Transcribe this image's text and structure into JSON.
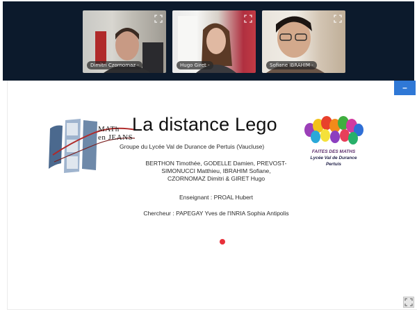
{
  "meeting": {
    "participants": [
      {
        "name": "Dimitri Czornomaz -"
      },
      {
        "name": "Hugo Giret -"
      },
      {
        "name": "Sofiane IBRAHIM -"
      }
    ]
  },
  "controls": {
    "minimize_label": "–",
    "expand_icon": "expand-icon",
    "fullscreen_icon": "fullscreen-icon"
  },
  "slide": {
    "title": "La distance Lego",
    "subtitle": "Groupe du Lycée Val de Durance de Pertuis (Vaucluse)",
    "authors_line1": "BERTHON Timothée, GODELLE Damien, PREVOST-",
    "authors_line2": "SIMONUCCI Matthieu, IBRAHIM Sofiane,",
    "authors_line3": "CZORNOMAZ Dimitri & GIRET Hugo",
    "teacher": "Enseignant : PROAL Hubert",
    "researcher": "Chercheur : PAPEGAY Yves de l'INRIA Sophia Antipolis",
    "logo_left_line1": "MATh",
    "logo_left_line2": "en JEANS",
    "logo_right_line1": "FAITES DES MATHS",
    "logo_right_line2": "Lycée Val de Durance",
    "logo_right_line3": "Pertuis"
  },
  "colors": {
    "topbar": "#0c1a2c",
    "accent": "#2f78d6",
    "laser": "#e8303a"
  }
}
